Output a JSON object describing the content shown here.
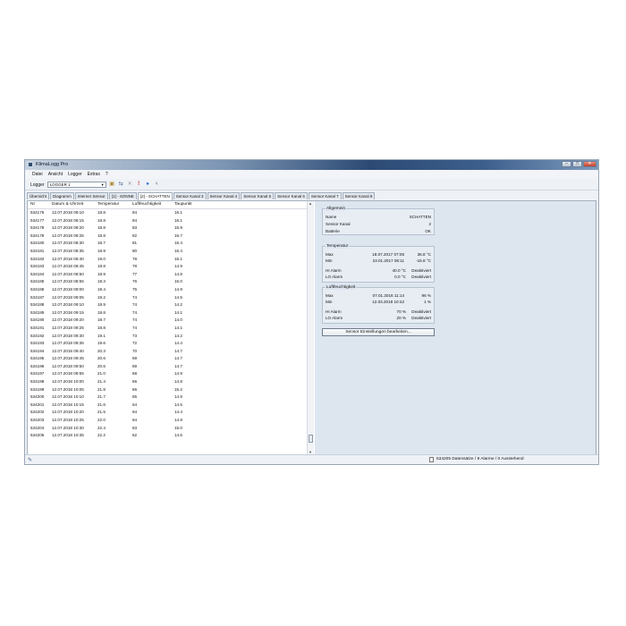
{
  "window": {
    "title": "KlimaLogg Pro"
  },
  "menu": [
    "Datei",
    "Ansicht",
    "Logger",
    "Extras",
    "?"
  ],
  "toolbar": {
    "logger_label": "Logger",
    "logger_value": "LOGGER 1"
  },
  "tabs": [
    {
      "label": "Übersicht",
      "active": false
    },
    {
      "label": "Diagramm",
      "active": false
    },
    {
      "label": "Interner Sensor",
      "active": false
    },
    {
      "label": "[1] - SONNE",
      "active": false
    },
    {
      "label": "[2] - SCHATTEN",
      "active": true
    },
    {
      "label": "Sensor Kanal 3",
      "active": false
    },
    {
      "label": "Sensor Kanal 4",
      "active": false
    },
    {
      "label": "Sensor Kanal 5",
      "active": false
    },
    {
      "label": "Sensor Kanal 6",
      "active": false
    },
    {
      "label": "Sensor Kanal 7",
      "active": false
    },
    {
      "label": "Sensor Kanal 8",
      "active": false
    }
  ],
  "table": {
    "columns": [
      "Nr",
      "Datum & Uhrzeit",
      "Temperatur",
      "Luftfeuchtigkeit",
      "Taupunkt"
    ],
    "rows": [
      [
        "534176",
        "12.07.2018 08:10",
        "18.8",
        "84",
        "16.1"
      ],
      [
        "534177",
        "12.07.2018 08:15",
        "18.8",
        "84",
        "16.1"
      ],
      [
        "534178",
        "12.07.2018 08:20",
        "18.8",
        "83",
        "15.9"
      ],
      [
        "534179",
        "12.07.2018 08:25",
        "18.8",
        "82",
        "15.7"
      ],
      [
        "534180",
        "12.07.2018 08:30",
        "18.7",
        "81",
        "15.4"
      ],
      [
        "534181",
        "12.07.2018 08:35",
        "18.9",
        "80",
        "15.4"
      ],
      [
        "534182",
        "12.07.2018 08:40",
        "19.0",
        "78",
        "15.1"
      ],
      [
        "534183",
        "12.07.2018 08:45",
        "18.8",
        "78",
        "14.9"
      ],
      [
        "534184",
        "12.07.2018 08:50",
        "18.9",
        "77",
        "14.8"
      ],
      [
        "534185",
        "12.07.2018 08:55",
        "19.3",
        "76",
        "15.0"
      ],
      [
        "534186",
        "12.07.2018 09:00",
        "19.4",
        "75",
        "14.9"
      ],
      [
        "534187",
        "12.07.2018 09:05",
        "19.2",
        "74",
        "14.5"
      ],
      [
        "534188",
        "12.07.2018 09:10",
        "18.9",
        "74",
        "14.2"
      ],
      [
        "534189",
        "12.07.2018 09:15",
        "18.8",
        "74",
        "14.1"
      ],
      [
        "534190",
        "12.07.2018 09:20",
        "18.7",
        "74",
        "14.0"
      ],
      [
        "534191",
        "12.07.2018 09:25",
        "18.8",
        "74",
        "14.1"
      ],
      [
        "534192",
        "12.07.2018 09:30",
        "19.1",
        "73",
        "14.2"
      ],
      [
        "534193",
        "12.07.2018 09:35",
        "19.6",
        "72",
        "14.4"
      ],
      [
        "534194",
        "12.07.2018 09:40",
        "20.3",
        "70",
        "14.7"
      ],
      [
        "534195",
        "12.07.2018 09:45",
        "20.6",
        "69",
        "14.7"
      ],
      [
        "534196",
        "12.07.2018 09:50",
        "20.6",
        "69",
        "14.7"
      ],
      [
        "534197",
        "12.07.2018 09:55",
        "21.0",
        "68",
        "14.9"
      ],
      [
        "534198",
        "12.07.2018 10:00",
        "21.4",
        "66",
        "14.8"
      ],
      [
        "534199",
        "12.07.2018 10:05",
        "21.8",
        "66",
        "15.2"
      ],
      [
        "534200",
        "12.07.2018 10:10",
        "21.7",
        "65",
        "14.9"
      ],
      [
        "534201",
        "12.07.2018 10:15",
        "21.6",
        "64",
        "14.5"
      ],
      [
        "534202",
        "12.07.2018 10:20",
        "21.5",
        "64",
        "14.4"
      ],
      [
        "534203",
        "12.07.2018 10:25",
        "22.0",
        "64",
        "14.9"
      ],
      [
        "534204",
        "12.07.2018 10:30",
        "22.4",
        "63",
        "15.0"
      ],
      [
        "534205",
        "12.07.2018 10:35",
        "22.2",
        "62",
        "14.6"
      ]
    ]
  },
  "info": {
    "general": {
      "title": "Allgemein",
      "name_label": "Name",
      "name_value": "SCHATTEN",
      "channel_label": "Sensor Kanal",
      "channel_value": "2",
      "battery_label": "Batterie",
      "battery_value": "OK"
    },
    "temperature": {
      "title": "Temperatur",
      "max_label": "Max",
      "max_date": "18.07.2017 07:06",
      "max_value": "36.8 °C",
      "min_label": "Min",
      "min_date": "23.01.2017 08:11",
      "min_value": "-15.8 °C",
      "hi_label": "HI Alarm",
      "hi_value": "40.0 °C",
      "hi_state": "Deaktiviert",
      "lo_label": "LO Alarm",
      "lo_value": "0.0 °C",
      "lo_state": "Deaktiviert"
    },
    "humidity": {
      "title": "Luftfeuchtigkeit",
      "max_label": "Max",
      "max_date": "07.01.2016 11:14",
      "max_value": "96 %",
      "min_label": "Min",
      "min_date": "12.03.2018 10:42",
      "min_value": "1 %",
      "hi_label": "HI Alarm",
      "hi_value": "70 %",
      "hi_state": "Deaktiviert",
      "lo_label": "LO Alarm",
      "lo_value": "20 %",
      "lo_state": "Deaktiviert"
    },
    "edit_button": "Sensor Einstellungen bearbeiten..."
  },
  "status": {
    "text": "534205 Datensätze / 9 Alarme / 0 Ausstehend"
  },
  "colors": {
    "title_gradient_dark": "#2c4a74",
    "info_bg": "#dde5ef",
    "window_bg": "#eef1f6"
  }
}
